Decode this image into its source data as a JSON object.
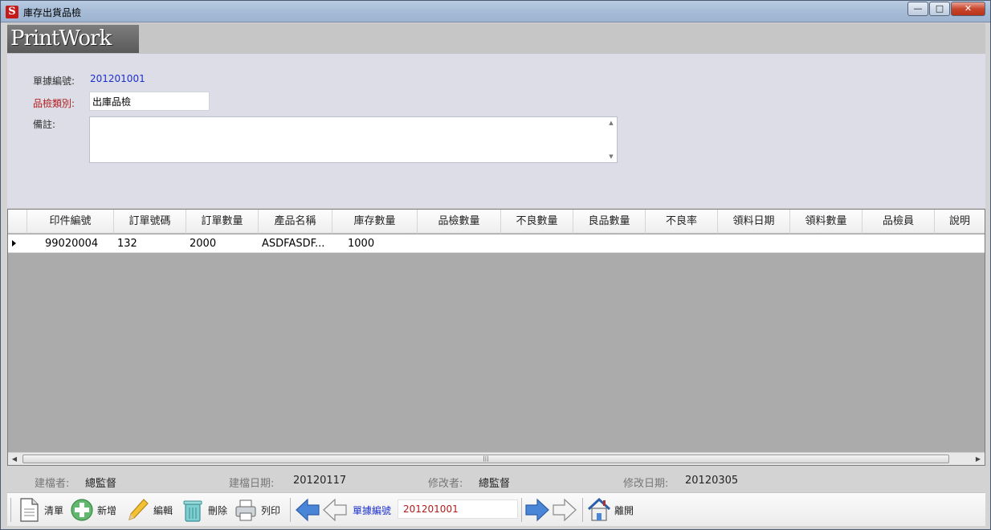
{
  "window": {
    "title": "庫存出貨品檢",
    "icon": "app-icon",
    "controls": [
      "minimize",
      "maximize",
      "close"
    ]
  },
  "banner": {
    "logo": "PrintWork"
  },
  "form": {
    "doc_no_label": "單據編號:",
    "doc_no_value": "201201001",
    "category_label": "品檢類別:",
    "category_value": "出庫品檢",
    "note_label": "備註:",
    "note_value": ""
  },
  "grid": {
    "columns": [
      "印件編號",
      "訂單號碼",
      "訂單數量",
      "產品名稱",
      "庫存數量",
      "品檢數量",
      "不良數量",
      "良品數量",
      "不良率",
      "領料日期",
      "領料數量",
      "品檢員",
      "說明"
    ],
    "rows": [
      [
        "99020004",
        "132",
        "2000",
        "ASDFASDF...",
        "1000",
        "",
        "",
        "",
        "",
        "",
        "",
        "",
        ""
      ]
    ]
  },
  "audit": {
    "creator_label": "建檔者:",
    "creator_value": "總監督",
    "created_date_label": "建檔日期:",
    "created_date_value": "20120117",
    "modifier_label": "修改者:",
    "modifier_value": "總監督",
    "modified_date_label": "修改日期:",
    "modified_date_value": "20120305"
  },
  "toolbar": {
    "list_label": "清單",
    "add_label": "新增",
    "edit_label": "編輯",
    "delete_label": "刪除",
    "print_label": "列印",
    "nav_label": "單據編號",
    "nav_value": "201201001",
    "exit_label": "離開"
  },
  "colors": {
    "accent_blue": "#1a2fcc",
    "required_red": "#b21c1c",
    "grid_bg": "#ababab",
    "form_bg": "#dcdde6"
  }
}
